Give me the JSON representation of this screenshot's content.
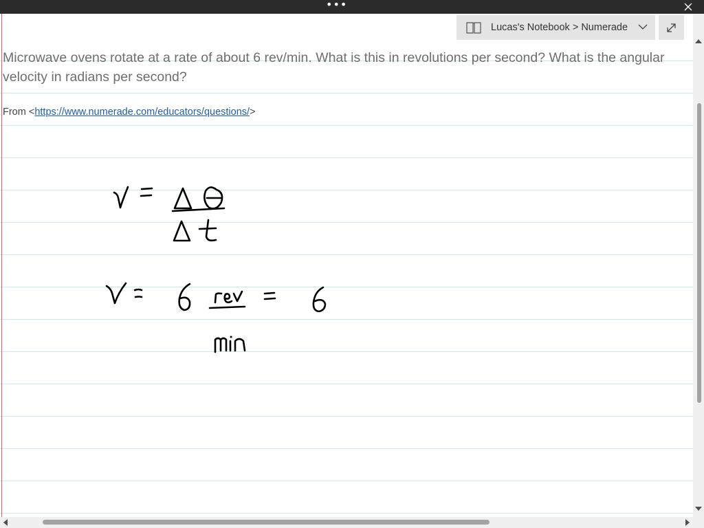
{
  "window": {
    "more_glyph": "•••",
    "title_bar_color": "#2b2b2b"
  },
  "breadcrumb": {
    "icon": "notebook-icon",
    "path": "Lucas's Notebook > Numerade"
  },
  "note": {
    "question": "Microwave ovens rotate at a rate of about 6 rev/min. What is this in revolutions per second? What is the angular velocity in radians per second?",
    "source_prefix": "From <",
    "source_url": "https://www.numerade.com/educators/questions/",
    "source_suffix": ">"
  },
  "ink": {
    "color": "#000000",
    "equations": [
      "v = Δθ / Δt",
      "v = 6 rev/min = 6"
    ]
  },
  "colors": {
    "rule_line": "#cfe6ea",
    "margin_line": "#e05a5a",
    "question_text": "#6e6e6e",
    "link": "#1f5fa8"
  }
}
